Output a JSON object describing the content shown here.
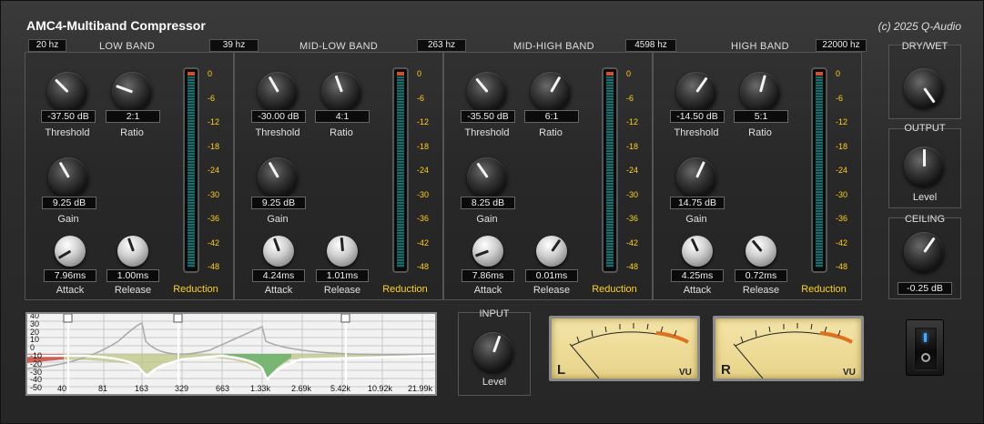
{
  "header": {
    "title": "AMC4-Multiband Compressor",
    "copyright": "(c) 2025 Q-Audio"
  },
  "crossovers": [
    "20 hz",
    "39 hz",
    "263 hz",
    "4598 hz",
    "22000 hz"
  ],
  "bands": [
    {
      "name": "LOW BAND",
      "threshold": "-37.50 dB",
      "ratio": "2:1",
      "gain": "9.25 dB",
      "attack": "7.96ms",
      "release": "1.00ms",
      "labels": {
        "threshold": "Threshold",
        "ratio": "Ratio",
        "gain": "Gain",
        "attack": "Attack",
        "release": "Release",
        "reduction": "Reduction"
      }
    },
    {
      "name": "MID-LOW BAND",
      "threshold": "-30.00 dB",
      "ratio": "4:1",
      "gain": "9.25 dB",
      "attack": "4.24ms",
      "release": "1.01ms",
      "labels": {
        "threshold": "Threshold",
        "ratio": "Ratio",
        "gain": "Gain",
        "attack": "Attack",
        "release": "Release",
        "reduction": "Reduction"
      }
    },
    {
      "name": "MID-HIGH BAND",
      "threshold": "-35.50 dB",
      "ratio": "6:1",
      "gain": "8.25 dB",
      "attack": "7.86ms",
      "release": "0.01ms",
      "labels": {
        "threshold": "Threshold",
        "ratio": "Ratio",
        "gain": "Gain",
        "attack": "Attack",
        "release": "Release",
        "reduction": "Reduction"
      }
    },
    {
      "name": "HIGH BAND",
      "threshold": "-14.50 dB",
      "ratio": "5:1",
      "gain": "14.75 dB",
      "attack": "4.25ms",
      "release": "0.72ms",
      "labels": {
        "threshold": "Threshold",
        "ratio": "Ratio",
        "gain": "Gain",
        "attack": "Attack",
        "release": "Release",
        "reduction": "Reduction"
      }
    }
  ],
  "meter_scale": [
    "0",
    "-6",
    "-12",
    "-18",
    "-24",
    "-30",
    "-36",
    "-42",
    "-48"
  ],
  "side": {
    "drywet_title": "DRY/WET",
    "output_title": "OUTPUT",
    "output_label": "Level",
    "ceiling_title": "CEILING",
    "ceiling_value": "-0.25 dB"
  },
  "input": {
    "title": "INPUT",
    "label": "Level"
  },
  "eq_display": {
    "y_labels": [
      "40",
      "30",
      "20",
      "10",
      "0",
      "-10",
      "-20",
      "-30",
      "-40",
      "-50"
    ],
    "x_labels": [
      "40",
      "81",
      "163",
      "329",
      "663",
      "1.33k",
      "2.69k",
      "5.42k",
      "10.92k",
      "21.99k"
    ]
  },
  "vu_meters": [
    {
      "channel": "L",
      "unit": "VU"
    },
    {
      "channel": "R",
      "unit": "VU"
    }
  ],
  "colors": {
    "accent_yellow": "#ffd21a",
    "meter_teal": "#1a6a6a",
    "vu_face": "#efdf9c"
  }
}
